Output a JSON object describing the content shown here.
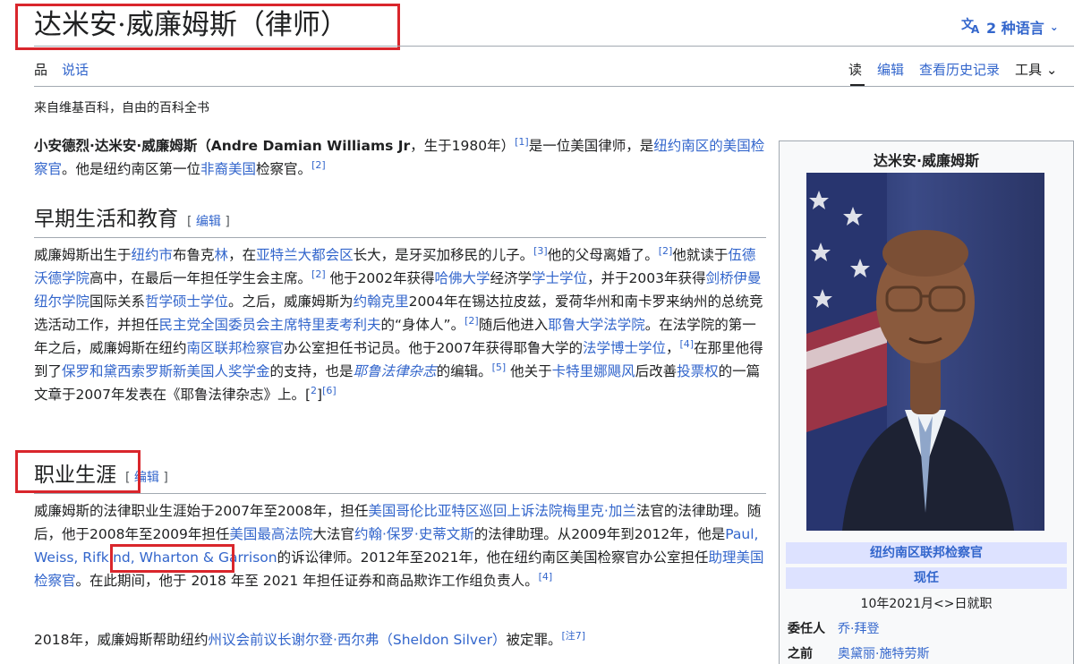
{
  "header": {
    "title": "达米安·威廉姆斯（律师）",
    "languages": "2 种语言",
    "lang_icon": "translate-icon"
  },
  "tabs": {
    "article": "品",
    "talk": "说话",
    "read": "读",
    "edit": "编辑",
    "history": "查看历史记录",
    "tools": "工具"
  },
  "tagline": "来自维基百科，自由的百科全书",
  "intro": {
    "name_bold": "小安德烈·达米安·威廉姆斯（Andre Damian Williams Jr",
    "t1": "，生于1980年）",
    "ref1": "[1]",
    "t2": "是一位美国律师，是",
    "link1": "纽约南区的美国检察官",
    "t3": "。他是纽约南区第一位",
    "link2": "非裔美国",
    "t4": "检察官。",
    "ref2": "[2]"
  },
  "sections": {
    "early": {
      "heading": "早期生活和教育",
      "edit": "编辑"
    },
    "career": {
      "heading": "职业生涯",
      "edit": "编辑"
    }
  },
  "early": {
    "p1a": "威廉姆斯出生于",
    "l_nyc": "纽约市",
    "p1b": "布鲁克",
    "l_brooklyn": "林",
    "p1c": "，在",
    "l_atlanta": "亚特兰大都会区",
    "p1d": "长大，是牙买加移民的儿子。",
    "r3": "[3]",
    "p1e": "他的父母离婚了。",
    "r2a": "[2]",
    "p1f": "他就读于",
    "l_woodward": "伍德沃德学院",
    "p1g": "高中，在最后一年担任学生会主席。",
    "r2b": "[2]",
    "p1h": " 他于2002年获得",
    "l_harvard": "哈佛大学",
    "p1i": "经济学",
    "l_ba": "学士学位",
    "p1j": "，并于2003年获得",
    "l_cambridge": "剑桥伊曼纽尔学院",
    "p1k": "国际关系",
    "l_mphil": "哲学硕士学位",
    "p1l": "。之后，威廉姆斯为",
    "l_kerry": "约翰克里",
    "p1m": "2004年在锡达拉皮兹，爱荷华州和南卡罗来纳州的总统竞选活动工作，并担任",
    "l_mcauliffe": "民主党全国委员会主席特里麦考利夫",
    "p1n": "的“身体人”。",
    "r2c": "[2]",
    "p1o": "随后他进入",
    "l_yale": "耶鲁大学法学院",
    "p1p": "。在法学院的第一年之后，威廉姆斯在纽约",
    "l_sdny": "南区联邦检察官",
    "p1q": "办公室担任书记员。他于2007年获得耶鲁大学的",
    "l_jd": "法学博士学位",
    "p1r": "，",
    "r4": "[4]",
    "p1s": "在那里他得到了",
    "l_soros": "保罗和黛西索罗斯新美国人奖学金",
    "p1t": "的支持，也是",
    "l_ylj": "耶鲁法律杂志",
    "p1u": "的编辑。",
    "r5": "[5]",
    "p1v": " 他关于",
    "l_katrina": "卡特里娜飓风",
    "p1w": "后改善",
    "l_vote": "投票权",
    "p1x": "的一篇文章于2007年发表在《耶鲁法律杂志》上。",
    "r2d": "[",
    "r2d_link": "2",
    "r2d_end": "]",
    "r6": "[6]"
  },
  "career": {
    "p1a": "威廉姆斯的法律职业生涯始于2007年至2008年，担任",
    "l_dc": "美国哥伦比亚特区巡回上诉法院梅里克·加兰",
    "p1b": "法官的法律助理。随后，他于2008年至2009年担任",
    "l_scotus": "美国最高法院",
    "p1c": "大法官",
    "l_stevens": "约翰·保罗·史蒂文斯",
    "p1d": "的法律助理。从2009年到2012年，他",
    "p1e": "是",
    "l_paul": "Paul, Weiss,",
    "l_rest": " Rifkind, Wharton & Garrison",
    "p1f": "的诉讼律师。2012年至2021年，他在纽约南区美国检察官办公室担任",
    "l_ausa": "助理美国检察官",
    "p1g": "。在此期间，他于 2018 年至 2021 年担任证券和商品欺诈工作组负责人。",
    "r4": "[4]",
    "p2a": "2018年，威廉姆斯帮助纽约",
    "l_silver": "州议会前议长谢尔登·西尔弗（Sheldon Silver）",
    "p2b": "被定罪。",
    "r7": "[注7]"
  },
  "infobox": {
    "title": "达米安·威廉姆斯",
    "office": "纽约南区联邦检察官",
    "incumbent": "现任",
    "start": "10年2021月<>日就职",
    "appointer_label": "委任人",
    "appointer": "乔·拜登",
    "predecessor_label": "之前",
    "predecessor": "奥黛丽·施特劳斯"
  }
}
